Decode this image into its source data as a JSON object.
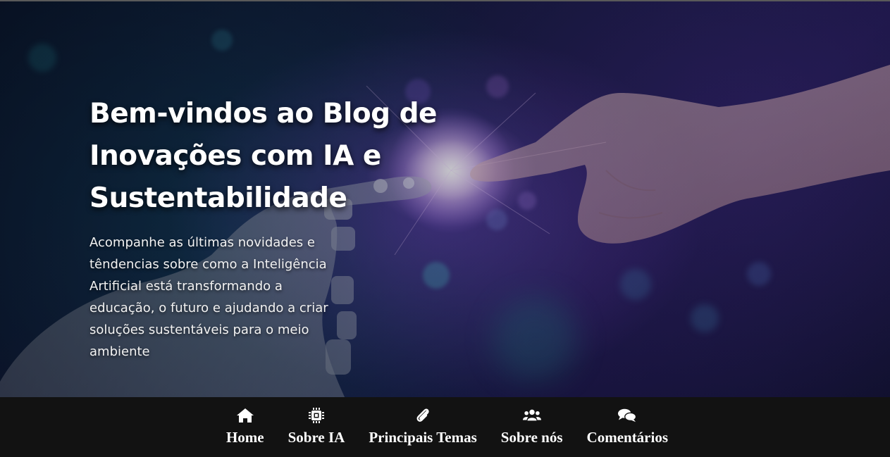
{
  "hero": {
    "title": "Bem-vindos ao Blog de Inovações com IA e Sustentabilidade",
    "subtitle": "Acompanhe as últimas novidades e têndencias sobre como a Inteligência Artificial está transformando a educação, o futuro e ajudando a criar soluções sustentáveis para o meio ambiente"
  },
  "nav": {
    "items": [
      {
        "label": "Home",
        "icon": "house-icon"
      },
      {
        "label": "Sobre IA",
        "icon": "microchip-icon"
      },
      {
        "label": "Principais Temas",
        "icon": "paperclip-icon"
      },
      {
        "label": "Sobre nós",
        "icon": "users-icon"
      },
      {
        "label": "Comentários",
        "icon": "comments-icon"
      }
    ]
  },
  "colors": {
    "navbar_background": "#121212",
    "nav_text": "#ffffff",
    "hero_text": "#ffffff"
  }
}
